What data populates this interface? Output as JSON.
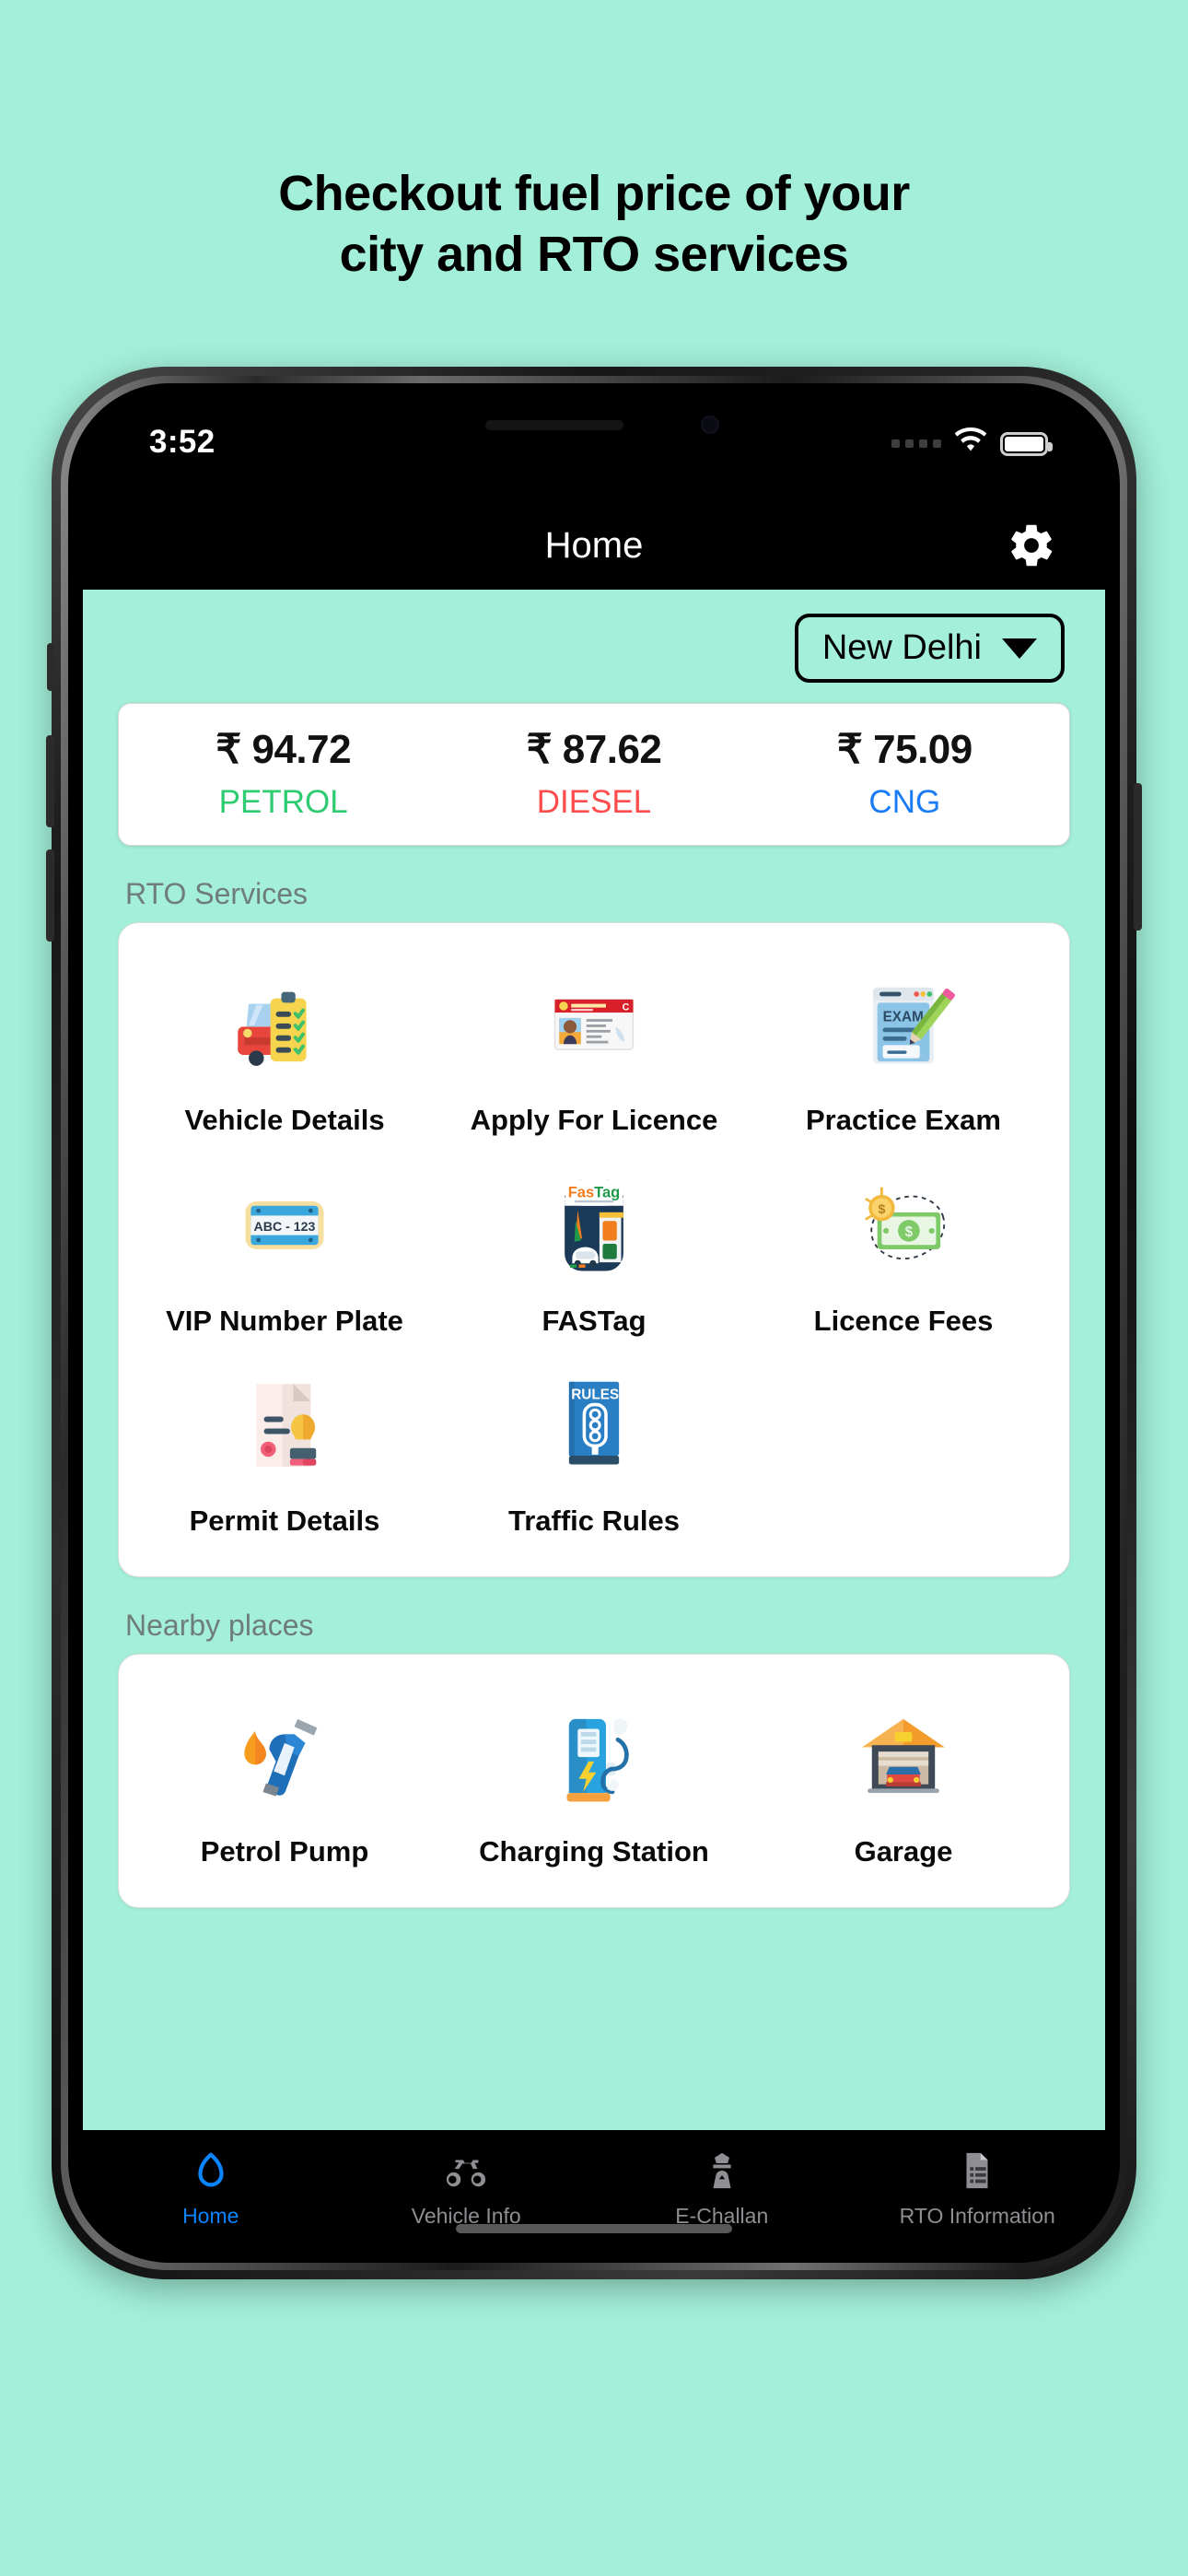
{
  "promo": {
    "line1": "Checkout fuel price of your",
    "line2": "city and RTO services"
  },
  "status_bar": {
    "time": "3:52",
    "wifi_icon": "wifi-icon",
    "battery_icon": "battery-full-icon",
    "signal_icon": "signal-dots-icon"
  },
  "header": {
    "title": "Home",
    "settings_icon": "gear-icon"
  },
  "city_selector": {
    "value": "New Delhi",
    "caret_icon": "chevron-down-icon"
  },
  "fuel_prices": [
    {
      "price": "₹ 94.72",
      "label": "PETROL",
      "color": "#2ecc71"
    },
    {
      "price": "₹ 87.62",
      "label": "DIESEL",
      "color": "#ff4d4d"
    },
    {
      "price": "₹ 75.09",
      "label": "CNG",
      "color": "#1a7cf5"
    }
  ],
  "rto_services": {
    "section_label": "RTO Services",
    "items": [
      {
        "label": "Vehicle Details",
        "icon": "car-checklist-icon"
      },
      {
        "label": "Apply For Licence",
        "icon": "driving-licence-card-icon"
      },
      {
        "label": "Practice Exam",
        "icon": "exam-paper-pencil-icon"
      },
      {
        "label": "VIP Number Plate",
        "icon": "number-plate-icon",
        "plate_text": "ABC - 123"
      },
      {
        "label": "FASTag",
        "icon": "fastag-toll-icon",
        "brand_text": "FasTag"
      },
      {
        "label": "Licence Fees",
        "icon": "money-coin-icon"
      },
      {
        "label": "Permit Details",
        "icon": "document-stamp-icon"
      },
      {
        "label": "Traffic Rules",
        "icon": "rules-book-icon",
        "book_text": "RULES"
      }
    ]
  },
  "nearby_places": {
    "section_label": "Nearby places",
    "items": [
      {
        "label": "Petrol Pump",
        "icon": "fuel-nozzle-icon"
      },
      {
        "label": "Charging Station",
        "icon": "ev-charger-icon"
      },
      {
        "label": "Garage",
        "icon": "garage-icon"
      }
    ]
  },
  "tabbar": {
    "items": [
      {
        "label": "Home",
        "icon": "home-icon",
        "active": true
      },
      {
        "label": "Vehicle Info",
        "icon": "motorcycle-icon",
        "active": false
      },
      {
        "label": "E-Challan",
        "icon": "police-officer-icon",
        "active": false
      },
      {
        "label": "RTO Information",
        "icon": "document-list-icon",
        "active": false
      }
    ]
  },
  "colors": {
    "page_background": "#a3efd9",
    "accent_blue": "#0a84ff",
    "section_label": "#6f7d78"
  }
}
